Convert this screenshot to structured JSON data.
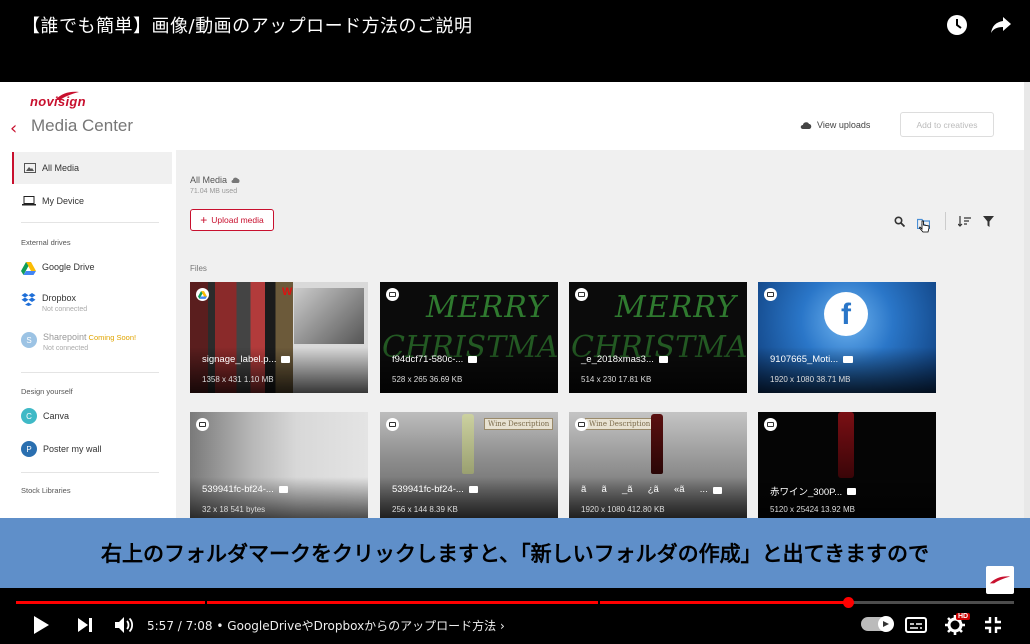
{
  "player": {
    "video_title": "【誰でも簡単】画像/動画のアップロード方法のご説明",
    "subtitle": "右上のフォルダマークをクリックしますと、「新しいフォルダの作成」と出てきますので",
    "time": "5:57 / 7:08",
    "chapter": "• GoogleDriveやDropboxからのアップロード方法",
    "chapter_arrow": "›",
    "progress_fraction": 0.834,
    "hd_badge": "HD",
    "icons": [
      "clock-icon",
      "share-icon",
      "play-icon",
      "next-icon",
      "volume-icon",
      "autoplay-toggle",
      "captions-icon",
      "settings-icon",
      "exit-fullscreen-icon"
    ]
  },
  "app": {
    "logo": "novisign",
    "back": "‹",
    "title": "Media Center",
    "view_uploads": "View uploads",
    "add_to_creatives": "Add to creatives"
  },
  "sidebar": {
    "all_media": "All Media",
    "my_device": "My Device",
    "external_label": "External drives",
    "google_drive": "Google Drive",
    "dropbox": "Dropbox",
    "dropbox_sub": "Not connected",
    "sharepoint": "Sharepoint",
    "coming_soon": "Coming Soon!",
    "sharepoint_sub": "Not connected",
    "design_label": "Design yourself",
    "canva": "Canva",
    "poster": "Poster my wall",
    "stock_label": "Stock Libraries"
  },
  "main": {
    "breadcrumb": "All Media",
    "used": "71.04 MB used",
    "upload": "Upload media",
    "files_label": "Files"
  },
  "files": [
    {
      "name": "signage_label.p...",
      "meta": "1358 x 431  1.10 MB",
      "type": "image"
    },
    {
      "name": "f94dcf71-580c-...",
      "meta": "528 x 265  36.69 KB",
      "type": "image"
    },
    {
      "name": "_e_2018xmas3...",
      "meta": "514 x 230  17.81 KB",
      "type": "image"
    },
    {
      "name": "9107665_Moti...",
      "meta": "1920 x 1080  38.71 MB",
      "type": "video"
    },
    {
      "name": "539941fc-bf24-...",
      "meta": "32 x 18  541 bytes",
      "type": "image"
    },
    {
      "name": "539941fc-bf24-...",
      "meta": "256 x 144  8.39 KB",
      "type": "image"
    },
    {
      "name": "ãã_ã¿ã«ã...",
      "meta": "1920 x 1080  412.80 KB",
      "type": "image"
    },
    {
      "name": "赤ワイン_300P...",
      "meta": "5120 x 25424  13.92 MB",
      "type": "image"
    }
  ],
  "thumb_text": {
    "merry": "MERRY",
    "christmas": "CHRISTMAS",
    "wine_description": "Wine Description"
  },
  "colors": {
    "brand_red": "#c8102e",
    "subtitle_band": "#5f8fc9",
    "progress": "#ff0000"
  }
}
